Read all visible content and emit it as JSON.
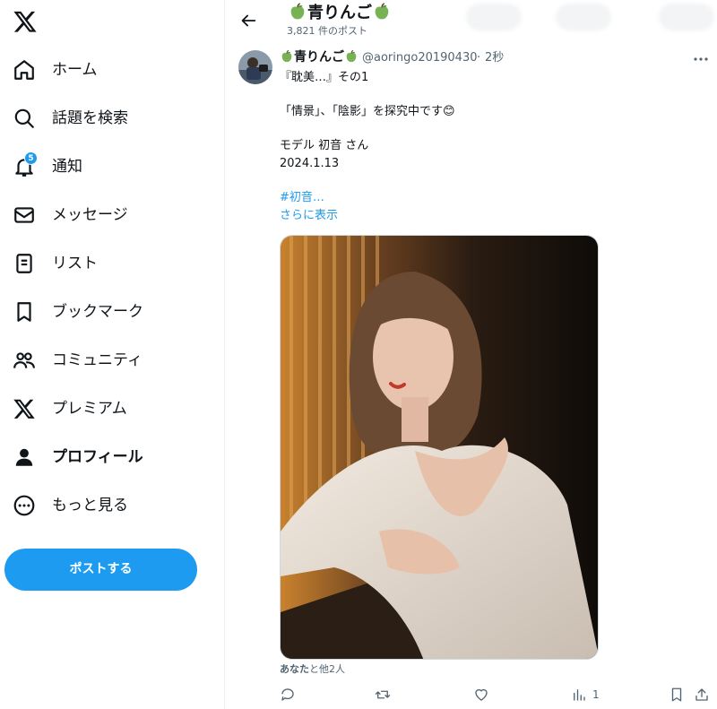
{
  "sidebar": {
    "logo": "x-logo-icon",
    "items": [
      {
        "label": "ホーム",
        "icon": "home-icon"
      },
      {
        "label": "話題を検索",
        "icon": "search-icon"
      },
      {
        "label": "通知",
        "icon": "bell-icon",
        "badge": "5"
      },
      {
        "label": "メッセージ",
        "icon": "mail-icon"
      },
      {
        "label": "リスト",
        "icon": "list-icon"
      },
      {
        "label": "ブックマーク",
        "icon": "bookmark-icon"
      },
      {
        "label": "コミュニティ",
        "icon": "communities-icon"
      },
      {
        "label": "プレミアム",
        "icon": "x-premium-icon"
      },
      {
        "label": "プロフィール",
        "icon": "profile-icon"
      },
      {
        "label": "もっと見る",
        "icon": "more-circle-icon"
      }
    ],
    "post_button": "ポストする"
  },
  "header": {
    "title": "青りんご",
    "title_emoji": "green-apple-emoji",
    "post_count": "3,821 件のポスト"
  },
  "tweet": {
    "author_name": "青りんご",
    "handle": "@aoringo20190430",
    "separator": "·",
    "time": "2秒",
    "text_lines": [
      "『耽美…』その1",
      "「情景」、「陰影」を探究中です😊",
      "モデル 初音 さん",
      "2024.1.13"
    ],
    "hashtag": "#初音…",
    "show_more": "さらに表示",
    "liked_by_name": "あなた",
    "liked_by_rest": "と他2人",
    "actions": {
      "reply": {
        "icon": "reply-icon",
        "count": ""
      },
      "retweet": {
        "icon": "retweet-icon",
        "count": ""
      },
      "like": {
        "icon": "heart-icon",
        "count": ""
      },
      "views": {
        "icon": "views-icon",
        "count": "1"
      },
      "bookmark": {
        "icon": "bookmark-icon"
      },
      "share": {
        "icon": "share-icon"
      }
    }
  },
  "colors": {
    "accent": "#1d9bf0",
    "text": "#0f1419",
    "muted": "#536471"
  }
}
